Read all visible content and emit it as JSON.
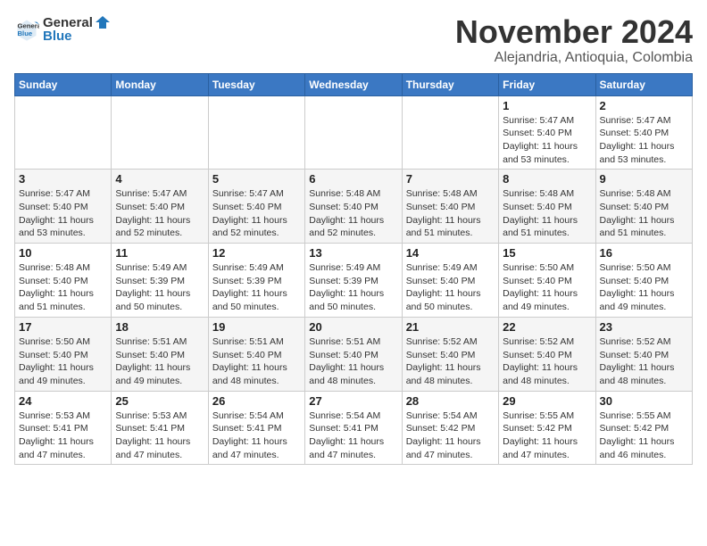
{
  "header": {
    "logo": {
      "general": "General",
      "blue": "Blue"
    },
    "title": "November 2024",
    "subtitle": "Alejandria, Antioquia, Colombia"
  },
  "calendar": {
    "days_of_week": [
      "Sunday",
      "Monday",
      "Tuesday",
      "Wednesday",
      "Thursday",
      "Friday",
      "Saturday"
    ],
    "weeks": [
      {
        "days": [
          {
            "num": "",
            "info": ""
          },
          {
            "num": "",
            "info": ""
          },
          {
            "num": "",
            "info": ""
          },
          {
            "num": "",
            "info": ""
          },
          {
            "num": "",
            "info": ""
          },
          {
            "num": "1",
            "info": "Sunrise: 5:47 AM\nSunset: 5:40 PM\nDaylight: 11 hours\nand 53 minutes."
          },
          {
            "num": "2",
            "info": "Sunrise: 5:47 AM\nSunset: 5:40 PM\nDaylight: 11 hours\nand 53 minutes."
          }
        ]
      },
      {
        "days": [
          {
            "num": "3",
            "info": "Sunrise: 5:47 AM\nSunset: 5:40 PM\nDaylight: 11 hours\nand 53 minutes."
          },
          {
            "num": "4",
            "info": "Sunrise: 5:47 AM\nSunset: 5:40 PM\nDaylight: 11 hours\nand 52 minutes."
          },
          {
            "num": "5",
            "info": "Sunrise: 5:47 AM\nSunset: 5:40 PM\nDaylight: 11 hours\nand 52 minutes."
          },
          {
            "num": "6",
            "info": "Sunrise: 5:48 AM\nSunset: 5:40 PM\nDaylight: 11 hours\nand 52 minutes."
          },
          {
            "num": "7",
            "info": "Sunrise: 5:48 AM\nSunset: 5:40 PM\nDaylight: 11 hours\nand 51 minutes."
          },
          {
            "num": "8",
            "info": "Sunrise: 5:48 AM\nSunset: 5:40 PM\nDaylight: 11 hours\nand 51 minutes."
          },
          {
            "num": "9",
            "info": "Sunrise: 5:48 AM\nSunset: 5:40 PM\nDaylight: 11 hours\nand 51 minutes."
          }
        ]
      },
      {
        "days": [
          {
            "num": "10",
            "info": "Sunrise: 5:48 AM\nSunset: 5:40 PM\nDaylight: 11 hours\nand 51 minutes."
          },
          {
            "num": "11",
            "info": "Sunrise: 5:49 AM\nSunset: 5:39 PM\nDaylight: 11 hours\nand 50 minutes."
          },
          {
            "num": "12",
            "info": "Sunrise: 5:49 AM\nSunset: 5:39 PM\nDaylight: 11 hours\nand 50 minutes."
          },
          {
            "num": "13",
            "info": "Sunrise: 5:49 AM\nSunset: 5:39 PM\nDaylight: 11 hours\nand 50 minutes."
          },
          {
            "num": "14",
            "info": "Sunrise: 5:49 AM\nSunset: 5:40 PM\nDaylight: 11 hours\nand 50 minutes."
          },
          {
            "num": "15",
            "info": "Sunrise: 5:50 AM\nSunset: 5:40 PM\nDaylight: 11 hours\nand 49 minutes."
          },
          {
            "num": "16",
            "info": "Sunrise: 5:50 AM\nSunset: 5:40 PM\nDaylight: 11 hours\nand 49 minutes."
          }
        ]
      },
      {
        "days": [
          {
            "num": "17",
            "info": "Sunrise: 5:50 AM\nSunset: 5:40 PM\nDaylight: 11 hours\nand 49 minutes."
          },
          {
            "num": "18",
            "info": "Sunrise: 5:51 AM\nSunset: 5:40 PM\nDaylight: 11 hours\nand 49 minutes."
          },
          {
            "num": "19",
            "info": "Sunrise: 5:51 AM\nSunset: 5:40 PM\nDaylight: 11 hours\nand 48 minutes."
          },
          {
            "num": "20",
            "info": "Sunrise: 5:51 AM\nSunset: 5:40 PM\nDaylight: 11 hours\nand 48 minutes."
          },
          {
            "num": "21",
            "info": "Sunrise: 5:52 AM\nSunset: 5:40 PM\nDaylight: 11 hours\nand 48 minutes."
          },
          {
            "num": "22",
            "info": "Sunrise: 5:52 AM\nSunset: 5:40 PM\nDaylight: 11 hours\nand 48 minutes."
          },
          {
            "num": "23",
            "info": "Sunrise: 5:52 AM\nSunset: 5:40 PM\nDaylight: 11 hours\nand 48 minutes."
          }
        ]
      },
      {
        "days": [
          {
            "num": "24",
            "info": "Sunrise: 5:53 AM\nSunset: 5:41 PM\nDaylight: 11 hours\nand 47 minutes."
          },
          {
            "num": "25",
            "info": "Sunrise: 5:53 AM\nSunset: 5:41 PM\nDaylight: 11 hours\nand 47 minutes."
          },
          {
            "num": "26",
            "info": "Sunrise: 5:54 AM\nSunset: 5:41 PM\nDaylight: 11 hours\nand 47 minutes."
          },
          {
            "num": "27",
            "info": "Sunrise: 5:54 AM\nSunset: 5:41 PM\nDaylight: 11 hours\nand 47 minutes."
          },
          {
            "num": "28",
            "info": "Sunrise: 5:54 AM\nSunset: 5:42 PM\nDaylight: 11 hours\nand 47 minutes."
          },
          {
            "num": "29",
            "info": "Sunrise: 5:55 AM\nSunset: 5:42 PM\nDaylight: 11 hours\nand 47 minutes."
          },
          {
            "num": "30",
            "info": "Sunrise: 5:55 AM\nSunset: 5:42 PM\nDaylight: 11 hours\nand 46 minutes."
          }
        ]
      }
    ]
  }
}
